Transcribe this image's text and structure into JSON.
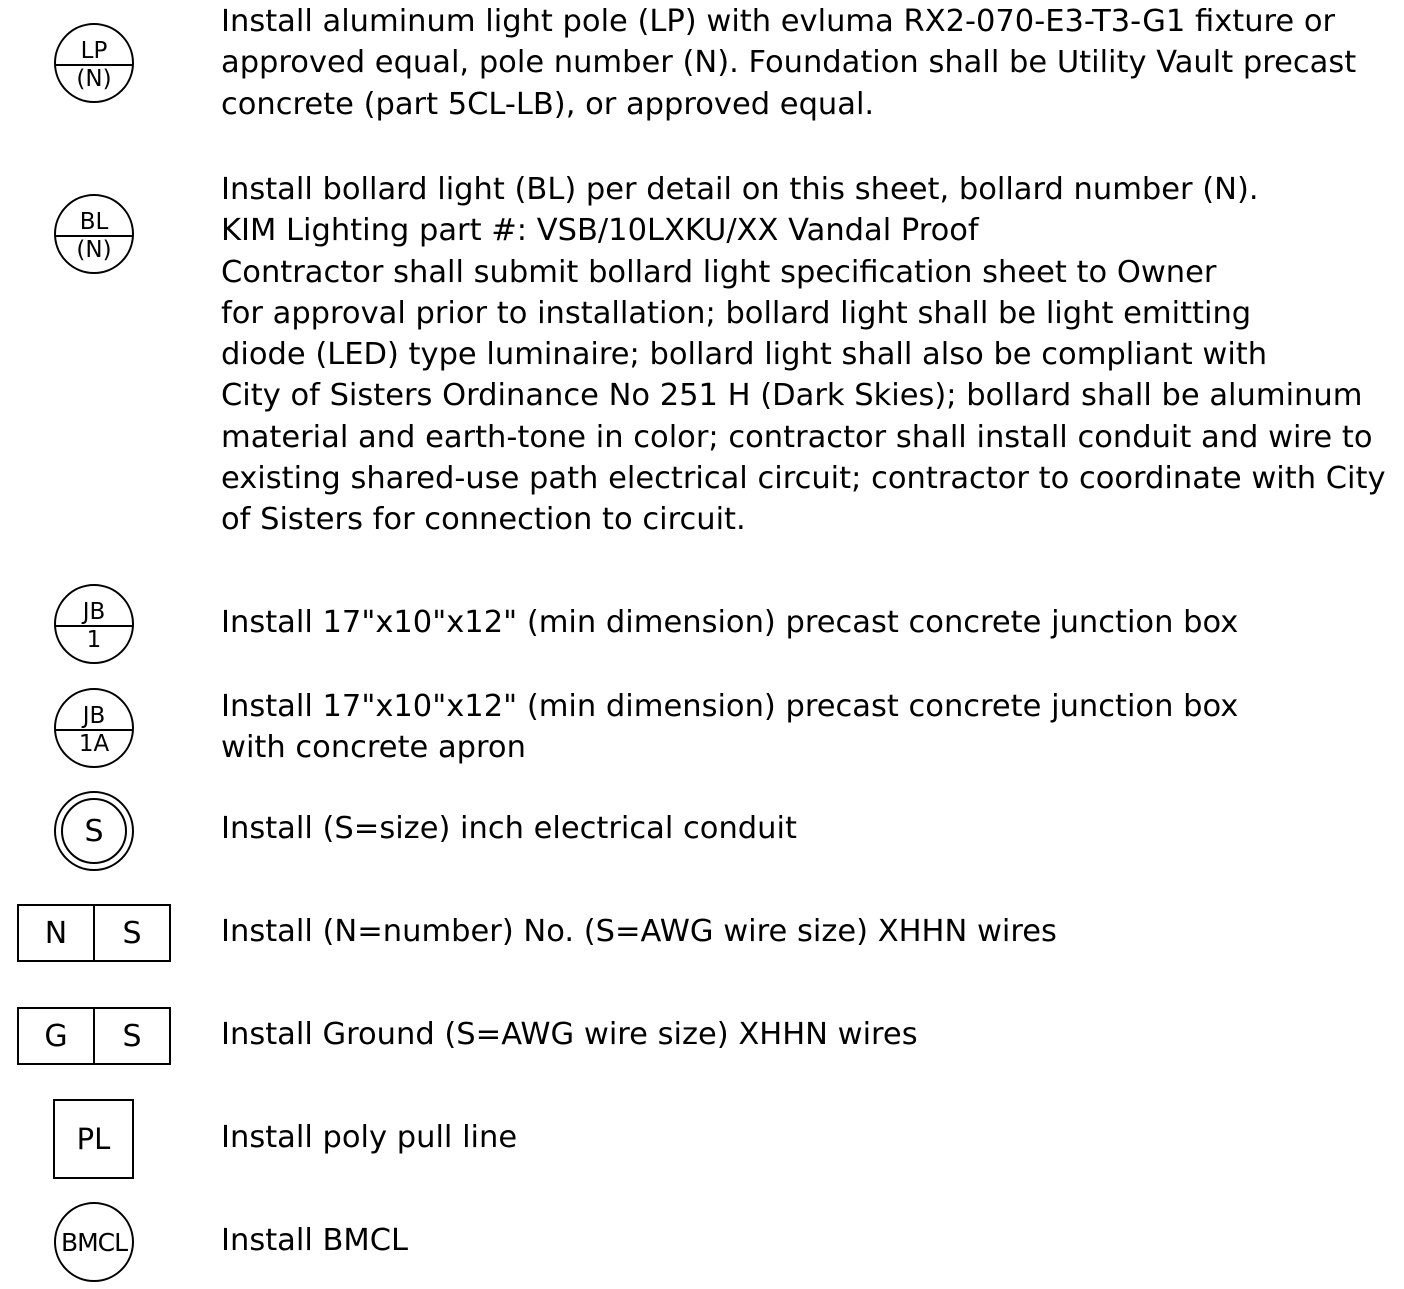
{
  "legend": {
    "light_pole": {
      "symbol_top": "LP",
      "symbol_bottom": "(N)",
      "lines": [
        "Install aluminum light pole (LP) with evluma RX2-070-E3-T3-G1 fixture or",
        "approved equal, pole number (N). Foundation shall be Utility Vault precast",
        "concrete (part 5CL-LB), or approved equal."
      ]
    },
    "bollard_light": {
      "symbol_top": "BL",
      "symbol_bottom": "(N)",
      "lines": [
        "Install bollard light (BL) per detail on this sheet, bollard number (N).",
        "KIM Lighting part #: VSB/10LXKU/XX Vandal Proof",
        "Contractor shall submit bollard light specification sheet to Owner",
        "for approval prior to installation; bollard light shall be light emitting",
        "diode (LED) type luminaire; bollard light shall also be compliant with",
        "City of Sisters Ordinance No 251 H (Dark Skies); bollard shall be aluminum",
        "material and earth-tone in color; contractor shall install conduit and wire to",
        "existing shared-use path electrical circuit; contractor to coordinate with City",
        "of Sisters for connection to circuit."
      ]
    },
    "junction_box_1": {
      "symbol_top": "JB",
      "symbol_bottom": "1",
      "lines": [
        "Install 17\"x10\"x12\" (min dimension) precast concrete junction box"
      ]
    },
    "junction_box_1a": {
      "symbol_top": "JB",
      "symbol_bottom": "1A",
      "lines": [
        "Install 17\"x10\"x12\" (min dimension) precast concrete junction box",
        "with concrete apron"
      ]
    },
    "conduit": {
      "symbol": "S",
      "lines": [
        "Install (S=size) inch electrical conduit"
      ]
    },
    "wires": {
      "symbol_left": "N",
      "symbol_right": "S",
      "lines": [
        "Install (N=number) No. (S=AWG wire size) XHHN wires"
      ]
    },
    "ground_wires": {
      "symbol_left": "G",
      "symbol_right": "S",
      "lines": [
        "Install Ground (S=AWG wire size) XHHN wires"
      ]
    },
    "pull_line": {
      "symbol": "PL",
      "lines": [
        "Install poly pull line"
      ]
    },
    "bmcl": {
      "symbol": "BMCL",
      "lines": [
        "Install BMCL"
      ]
    }
  }
}
